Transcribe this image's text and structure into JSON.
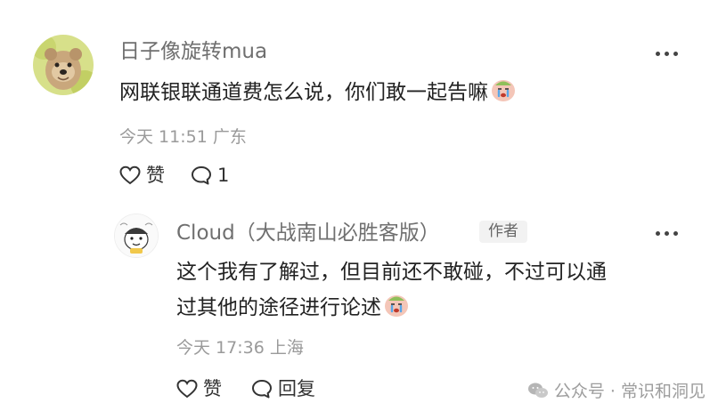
{
  "comment": {
    "username": "日子像旋转mua",
    "text": "网联银联通道费怎么说，你们敢一起告嘛",
    "emoji": "crying-face",
    "time": "今天 11:51",
    "location": "广东",
    "like_label": "赞",
    "reply_count": "1"
  },
  "reply": {
    "username": "Cloud（大战南山必胜客版）",
    "author_badge": "作者",
    "text_line1": "这个我有了解过，但目前还不敢碰，不过可以通",
    "text_line2": "过其他的途径进行论述",
    "emoji": "crying-face",
    "time": "今天 17:36",
    "location": "上海",
    "like_label": "赞",
    "reply_label": "回复"
  },
  "watermark": {
    "text": "公众号 · 常识和洞见"
  },
  "colors": {
    "username": "#6f6f6f",
    "meta": "#9a9a9a",
    "text": "#222222",
    "badge_bg": "#f2f2f2"
  }
}
